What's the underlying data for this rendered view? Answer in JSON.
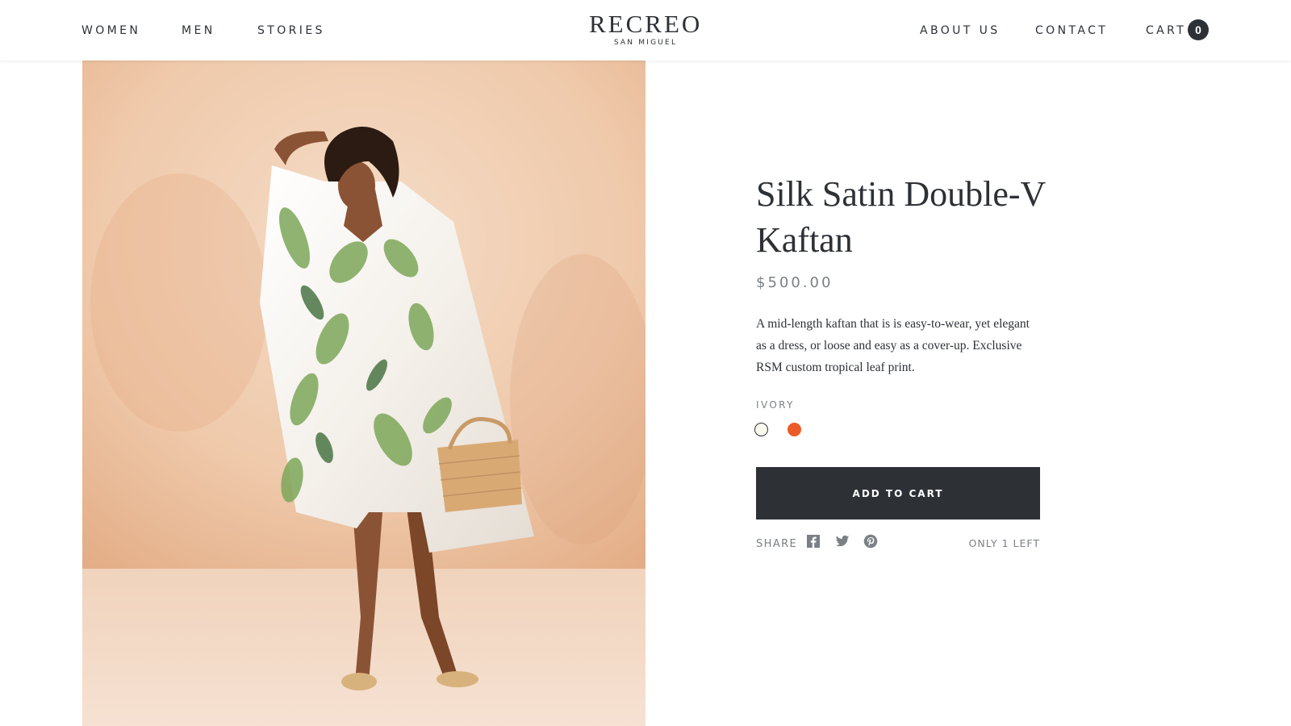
{
  "header": {
    "nav_left": [
      "WOMEN",
      "MEN",
      "STORIES"
    ],
    "logo_main": "RECREO",
    "logo_sub": "SAN MIGUEL",
    "nav_right": [
      "ABOUT US",
      "CONTACT",
      "CART"
    ],
    "cart_count": "0"
  },
  "product": {
    "title": "Silk Satin Double-V Kaftan",
    "price": "$500.00",
    "description": "A mid-length kaftan that is is easy-to-wear, yet elegant as a dress, or loose and easy as a cover-up. Exclusive RSM custom tropical leaf print.",
    "color_label": "IVORY",
    "colors": [
      {
        "name": "ivory",
        "hex": "#fbfaec",
        "selected": true
      },
      {
        "name": "orange",
        "hex": "#ec5a2a",
        "selected": false
      }
    ],
    "add_to_cart": "ADD TO CART",
    "share_label": "SHARE",
    "share_icons": [
      "facebook-icon",
      "twitter-icon",
      "pinterest-icon"
    ],
    "stock": "ONLY 1 LEFT"
  },
  "theme": {
    "text": "#2d3136",
    "muted": "#7b7f86",
    "button": "#2d3136"
  }
}
